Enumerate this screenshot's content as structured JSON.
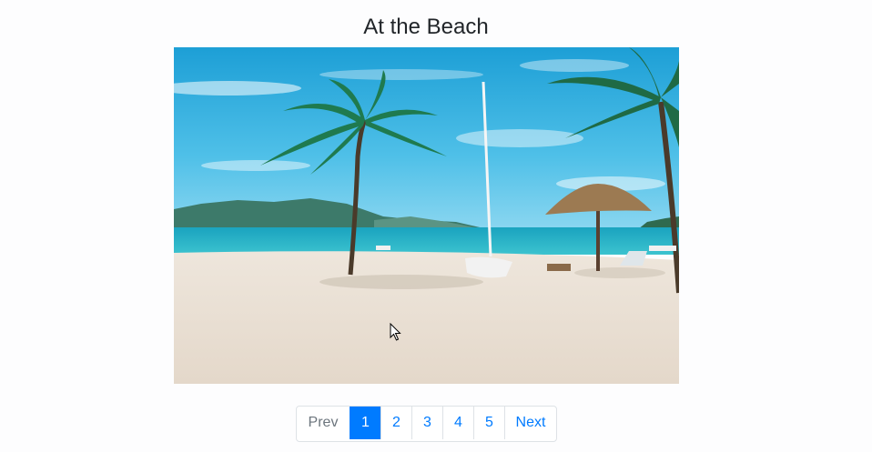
{
  "gallery": {
    "title": "At the Beach"
  },
  "image": {
    "subject": "beach-scene"
  },
  "pagination": {
    "prev_label": "Prev",
    "pages": [
      "1",
      "2",
      "3",
      "4",
      "5"
    ],
    "active_page": "1",
    "next_label": "Next"
  },
  "colors": {
    "accent": "#007bff",
    "disabled": "#6c757d",
    "border": "#dee2e6",
    "title": "#212529"
  }
}
